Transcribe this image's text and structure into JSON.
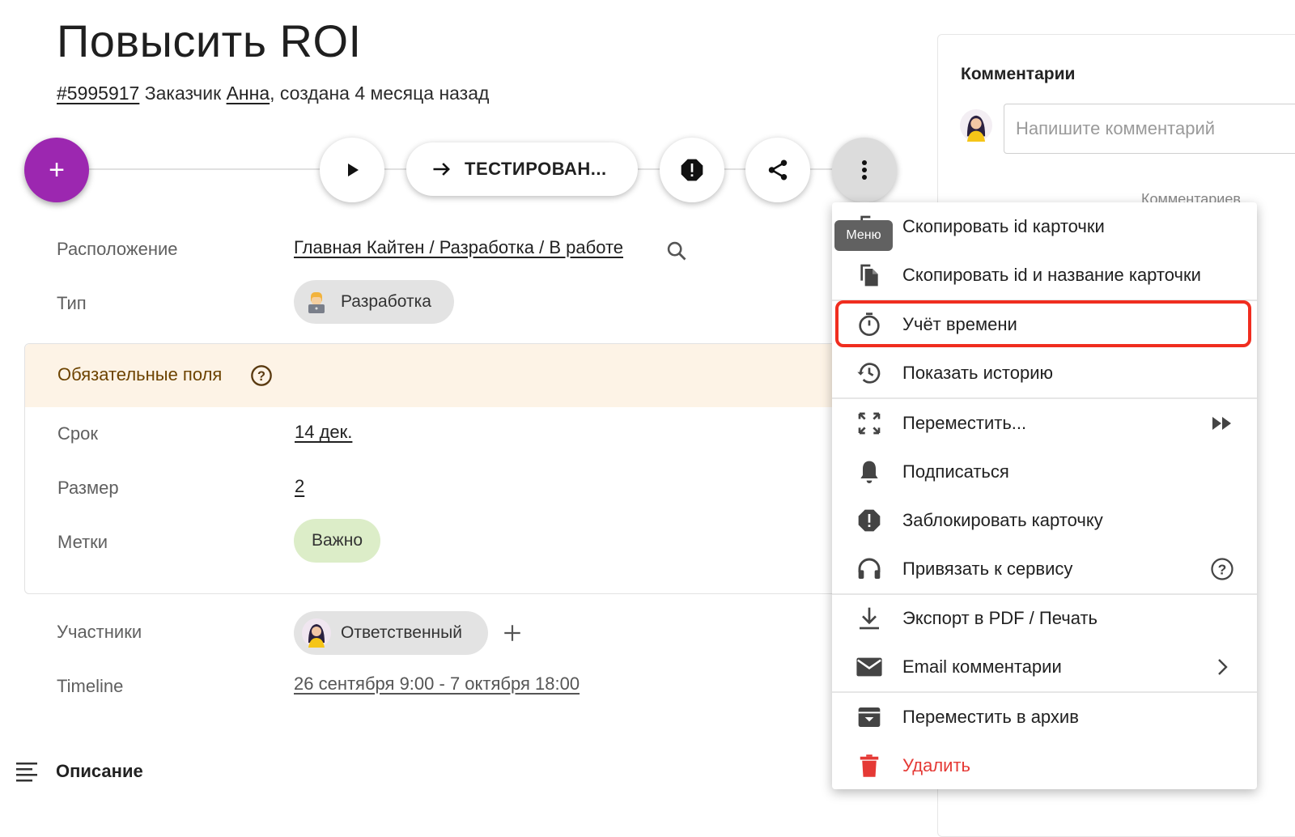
{
  "card": {
    "title": "Повысить ROI",
    "id": "#5995917",
    "customer_prefix": "Заказчик",
    "customer": "Анна",
    "created": ", создана 4 месяца назад"
  },
  "toolbar": {
    "add_label": "+",
    "move_label": "ТЕСТИРОВАН...",
    "more_tooltip": "Меню"
  },
  "fields": {
    "location_label": "Расположение",
    "location_value": "Главная Кайтен / Разработка / В работе",
    "type_label": "Тип",
    "type_value": "Разработка",
    "required_title": "Обязательные поля",
    "deadline_label": "Срок",
    "deadline_value": "14 дек.",
    "size_label": "Размер",
    "size_value": "2",
    "tags_label": "Метки",
    "tag_value": "Важно",
    "members_label": "Участники",
    "member_value": "Ответственный",
    "timeline_label": "Timeline",
    "timeline_value": "26 сентября 9:00 - 7 октября 18:00",
    "description_label": "Описание"
  },
  "comments": {
    "title": "Комментарии",
    "placeholder": "Напишите комментарий",
    "count_text": "Комментариев"
  },
  "menu": {
    "items": [
      {
        "label": "Скопировать id карточки",
        "icon": "copy-icon"
      },
      {
        "label": "Скопировать id и название карточки",
        "icon": "copy-icon"
      },
      {
        "label": "Учёт времени",
        "icon": "timer-icon",
        "highlighted": true
      },
      {
        "label": "Показать историю",
        "icon": "history-icon"
      },
      {
        "label": "Переместить...",
        "icon": "move-icon",
        "trailing": "fast-forward-icon"
      },
      {
        "label": "Подписаться",
        "icon": "bell-icon"
      },
      {
        "label": "Заблокировать карточку",
        "icon": "block-icon"
      },
      {
        "label": "Привязать к сервису",
        "icon": "headset-icon",
        "trailing": "help-icon"
      },
      {
        "label": "Экспорт в PDF / Печать",
        "icon": "download-icon"
      },
      {
        "label": "Email комментарии",
        "icon": "mail-icon",
        "trailing": "chevron-right-icon"
      },
      {
        "label": "Переместить в архив",
        "icon": "archive-icon"
      },
      {
        "label": "Удалить",
        "icon": "trash-icon",
        "color": "#e53935"
      }
    ]
  },
  "colors": {
    "accent": "#9c27b0",
    "highlight": "#f02d1f",
    "danger": "#e53935",
    "required_bg": "#fdf3e6",
    "tag_bg": "#dcedc8"
  }
}
